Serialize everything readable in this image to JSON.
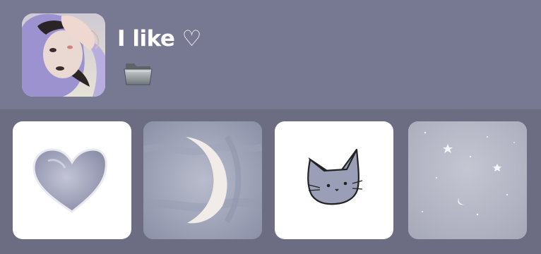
{
  "profile": {
    "title": "I like ♡",
    "avatar_icon": "avatar-photo",
    "folder_icon": "folder-icon"
  },
  "tiles": [
    {
      "icon": "heart-icon"
    },
    {
      "icon": "crescent-moon-icon"
    },
    {
      "icon": "cat-face-icon"
    },
    {
      "icon": "starry-sky-icon"
    }
  ],
  "colors": {
    "header_bg": "#777891",
    "body_bg": "#6c6d83",
    "title_text": "#ffffff"
  }
}
